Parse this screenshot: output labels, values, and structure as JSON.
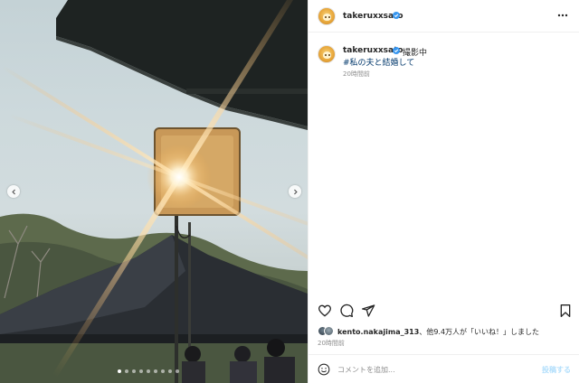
{
  "post": {
    "username": "takeruxxsato",
    "verified": true,
    "caption": {
      "username": "takeruxxsato",
      "text": "撮影中",
      "hashtag": "#私の夫と結婚して",
      "time": "20時間前"
    },
    "likes": {
      "liker": "kento.nakajima_313",
      "suffix": "、他9.4万人が「いいね！」しました"
    },
    "post_time": "20時間前",
    "comment": {
      "placeholder": "コメントを追加...",
      "post_label": "投稿する"
    },
    "carousel": {
      "total": 9,
      "active_index": 0
    }
  },
  "colors": {
    "link": "#00376b",
    "muted": "#8e8e8e",
    "post_button_disabled": "#b2dffc",
    "verified": "#3897f0"
  },
  "icons": {
    "more": "more-horizontal-icon",
    "like": "heart-icon",
    "comment": "comment-bubble-icon",
    "share": "paper-plane-icon",
    "save": "bookmark-icon",
    "emoji": "smiley-icon",
    "prev": "chevron-left-icon",
    "next": "chevron-right-icon"
  }
}
